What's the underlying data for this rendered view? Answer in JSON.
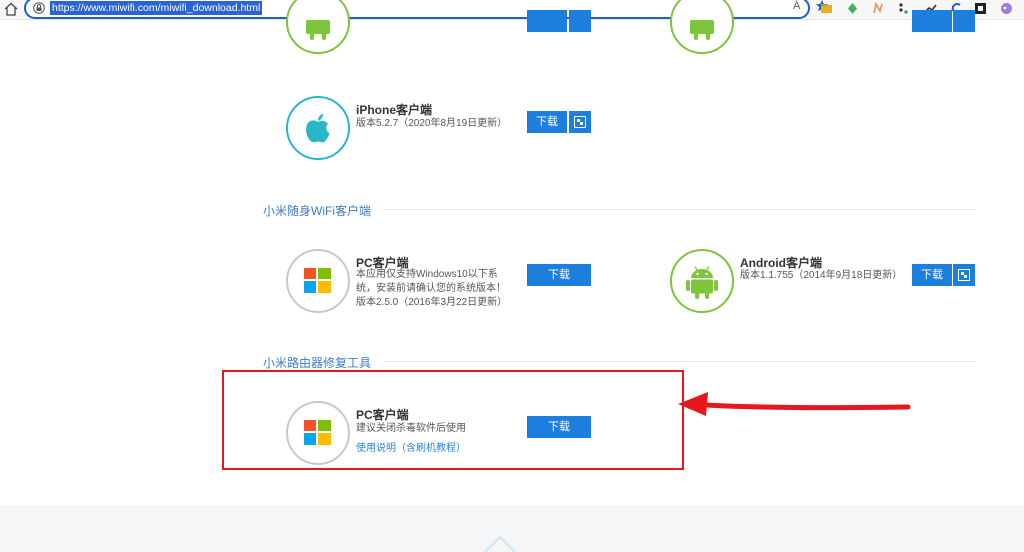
{
  "browser": {
    "url": "https://www.miwifi.com/miwifi_download.html",
    "reader_label": "Á"
  },
  "top_partial": {
    "left_icon": "android-icon",
    "right_icon": "android-icon"
  },
  "iphone": {
    "title": "iPhone客户端",
    "version": "版本5.2.7（2020年8月19日更新）",
    "download_label": "下载"
  },
  "section_wifi": {
    "title": "小米随身WiFi客户端",
    "pc": {
      "title": "PC客户端",
      "desc_line1": "本应用仅支持Windows10以下系",
      "desc_line2": "统，安装前请确认您的系统版本！",
      "version": "版本2.5.0（2016年3月22日更新）",
      "download_label": "下载"
    },
    "android": {
      "title": "Android客户端",
      "version": "版本1.1.755（2014年9月18日更新）",
      "download_label": "下载"
    }
  },
  "section_repair": {
    "title": "小米路由器修复工具",
    "pc": {
      "title": "PC客户端",
      "desc": "建议关闭杀毒软件后使用",
      "link": "使用说明（含刷机教程）",
      "download_label": "下载"
    }
  },
  "colors": {
    "accent": "#1c7fde",
    "section_title": "#3b7cc6",
    "annotation": "#e7171e",
    "android_green": "#7dc53b",
    "apple_teal": "#29b7c7"
  }
}
